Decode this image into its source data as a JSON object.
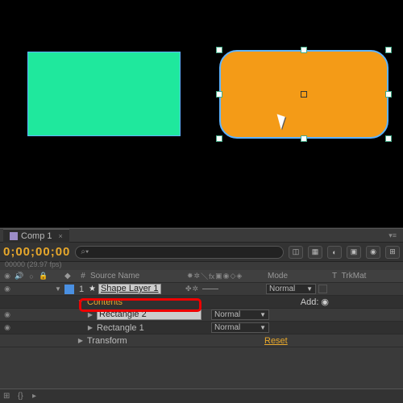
{
  "viewport": {
    "green_shape": "rectangle",
    "orange_shape": "rounded-rectangle-selected"
  },
  "timeline": {
    "comp_tab": "Comp 1",
    "timecode": "0;00;00;00",
    "frames_label": "00000 (29.97 fps)",
    "search_placeholder": "",
    "headers": {
      "num": "#",
      "source_name": "Source Name",
      "mode": "Mode",
      "trkmat": "TrkMat",
      "t": "T"
    },
    "layer": {
      "index": "1",
      "name": "Shape Layer 1",
      "color": "#4a90e2",
      "mode": "Normal"
    },
    "contents_label": "Contents",
    "add_label": "Add:",
    "rect2": {
      "name": "Rectangle 2",
      "mode": "Normal"
    },
    "rect1": {
      "name": "Rectangle 1",
      "mode": "Normal"
    },
    "transform_label": "Transform",
    "reset_label": "Reset"
  }
}
